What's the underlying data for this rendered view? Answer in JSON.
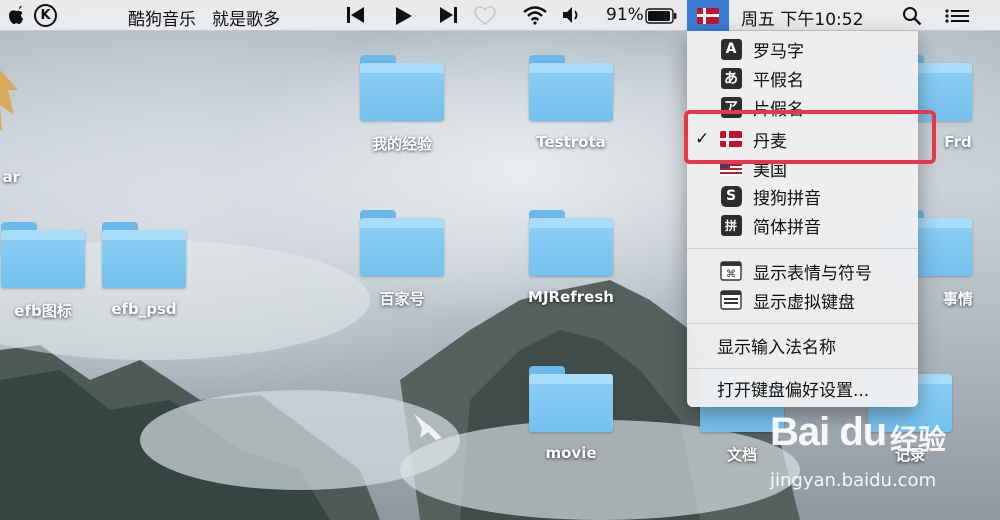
{
  "menubar": {
    "app_name": "酷狗音乐",
    "song_title": "就是歌多",
    "battery": "91%",
    "clock": "周五 下午10:52",
    "icons": [
      "apple-icon",
      "kugou-icon",
      "prev-track-icon",
      "play-icon",
      "next-track-icon",
      "heart-icon",
      "wifi-icon",
      "volume-icon",
      "battery-icon",
      "input-source-flag-icon",
      "search-icon",
      "list-icon"
    ]
  },
  "desktop": {
    "items": [
      {
        "label": "ar"
      },
      {
        "label": "我的经验"
      },
      {
        "label": "Testrota"
      },
      {
        "label": "Frd"
      },
      {
        "label": "efb图标"
      },
      {
        "label": "efb_psd"
      },
      {
        "label": "百家号"
      },
      {
        "label": "MJRefresh"
      },
      {
        "label": "事情"
      },
      {
        "label": "movie"
      },
      {
        "label": "文档"
      },
      {
        "label": "记录"
      }
    ]
  },
  "input_menu": {
    "items": [
      {
        "icon_text": "A",
        "label": "罗马字",
        "checked": false
      },
      {
        "icon_text": "あ",
        "label": "平假名",
        "checked": false
      },
      {
        "icon_text": "ア",
        "label": "片假名",
        "checked": false
      },
      {
        "icon_text": "",
        "label": "丹麦",
        "checked": true,
        "check_mark": "✓"
      },
      {
        "icon_text": "",
        "label": "美国",
        "checked": false
      },
      {
        "icon_text": "S",
        "label": "搜狗拼音",
        "checked": false
      },
      {
        "icon_text": "拼",
        "label": "简体拼音",
        "checked": false
      }
    ],
    "show_emoji": "显示表情与符号",
    "show_keyboard": "显示虚拟键盘",
    "show_input_name": "显示输入法名称",
    "open_prefs": "打开键盘偏好设置..."
  },
  "watermark": {
    "brand": "Bai du",
    "jingyan": "经验",
    "url": "jingyan.baidu.com"
  },
  "colors": {
    "highlight_box": "#e8364a",
    "menubar_selected": "#3a7bd5",
    "folder": "#74c1ef"
  }
}
